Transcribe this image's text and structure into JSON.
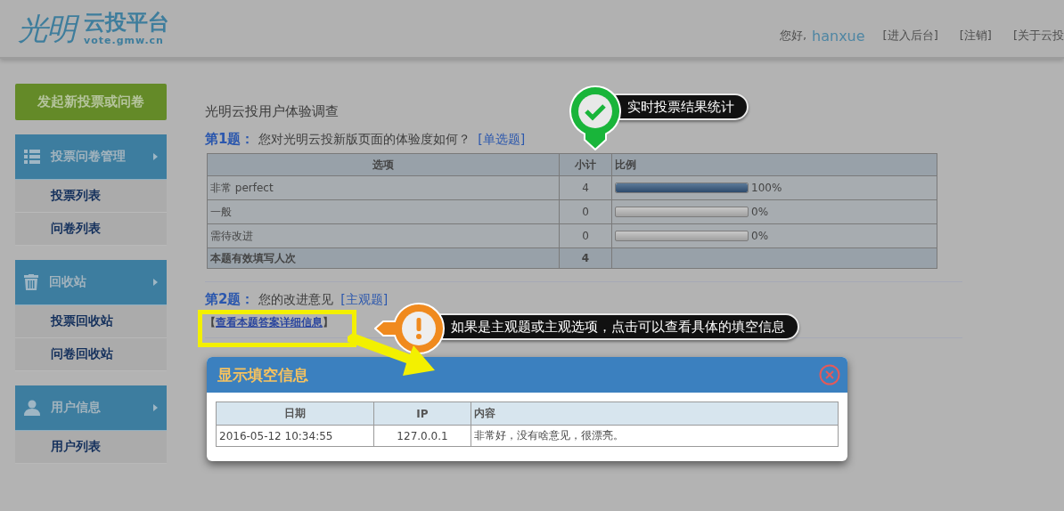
{
  "header": {
    "logo": {
      "mark": "光明",
      "name": "云投平台",
      "domain": "vote.gmw.cn"
    },
    "greeting": "您好,",
    "username": "hanxue",
    "links": [
      "[进入后台]",
      "[注销]",
      "[关于云投"
    ]
  },
  "sidebar": {
    "primary_button": "发起新投票或问卷",
    "groups": [
      {
        "title": "投票问卷管理",
        "items": [
          "投票列表",
          "问卷列表"
        ]
      },
      {
        "title": "回收站",
        "items": [
          "投票回收站",
          "问卷回收站"
        ]
      },
      {
        "title": "用户信息",
        "items": [
          "用户列表"
        ]
      }
    ]
  },
  "survey_title": "光明云投用户体验调查",
  "question_1": {
    "number": "第1题：",
    "text": "您对光明云投新版页面的体验度如何？",
    "type": "[单选题]",
    "columns": [
      "选项",
      "小计",
      "比例"
    ],
    "rows": [
      {
        "option": "非常 perfect",
        "count": "4",
        "level": 1,
        "percent": "100%"
      },
      {
        "option": "一般",
        "count": "0",
        "level": 0,
        "percent": "0%"
      },
      {
        "option": "需待改进",
        "count": "0",
        "level": 0,
        "percent": "0%"
      }
    ],
    "total": {
      "label": "本题有效填写人次",
      "count": "4"
    }
  },
  "question_2": {
    "number": "第2题：",
    "text": "您的改进意见",
    "type": "[主观题]",
    "link_open": "【",
    "link": "查看本题答案详细信息",
    "link_close": "】"
  },
  "callouts": [
    {
      "kind": "success",
      "text": "实时投票结果统计"
    },
    {
      "kind": "warning",
      "text": "如果是主观题或主观选项，点击可以查看具体的填空信息"
    }
  ],
  "modal": {
    "title": "显示填空信息",
    "columns": [
      "日期",
      "IP",
      "内容"
    ],
    "rows": [
      [
        "2016-05-12 10:34:55",
        "127.0.0.1",
        "非常好，没有啥意见，很漂亮。"
      ]
    ]
  }
}
